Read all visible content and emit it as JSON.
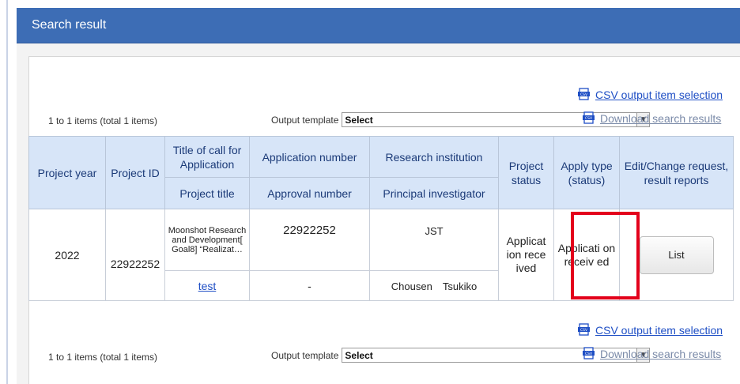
{
  "header": {
    "title": "Search result"
  },
  "top_bar": {
    "csv_link": "CSV output item selection",
    "count_text": "1 to 1 items (total 1 items)",
    "template_label": "Output template",
    "template_value": "Select",
    "download_link": "Download search results"
  },
  "bottom_bar": {
    "csv_link": "CSV output item selection",
    "count_text": "1 to 1 items (total 1 items)",
    "template_label": "Output template",
    "template_value": "Select",
    "download_link": "Download search results"
  },
  "table": {
    "headers": {
      "project_year": "Project year",
      "project_id": "Project ID",
      "call_title": "Title of call for Application",
      "project_title": "Project title",
      "application_number": "Application number",
      "approval_number": "Approval number",
      "research_institution": "Research institution",
      "principal_investigator": "Principal investigator",
      "project_status": "Project status",
      "apply_type": "Apply type (status)",
      "edit_change": "Edit/Change request, result reports"
    },
    "rows": [
      {
        "project_year": "2022",
        "project_id": "22922252",
        "call_title": "Moonshot Research and Development[ Goal8] “Realizat…",
        "project_title": "test",
        "application_number": "22922252",
        "approval_number": "-",
        "research_institution": "JST",
        "principal_investigator": "Chousen　Tsukiko",
        "project_status": "Applicat ion rece ived",
        "apply_type": "Applicati on receiv ed",
        "action_label": "List"
      }
    ]
  },
  "colors": {
    "header_bg": "#3d6db5",
    "table_header_bg": "#d7e5f8",
    "link": "#1f4fc5",
    "highlight": "#e3001b"
  }
}
